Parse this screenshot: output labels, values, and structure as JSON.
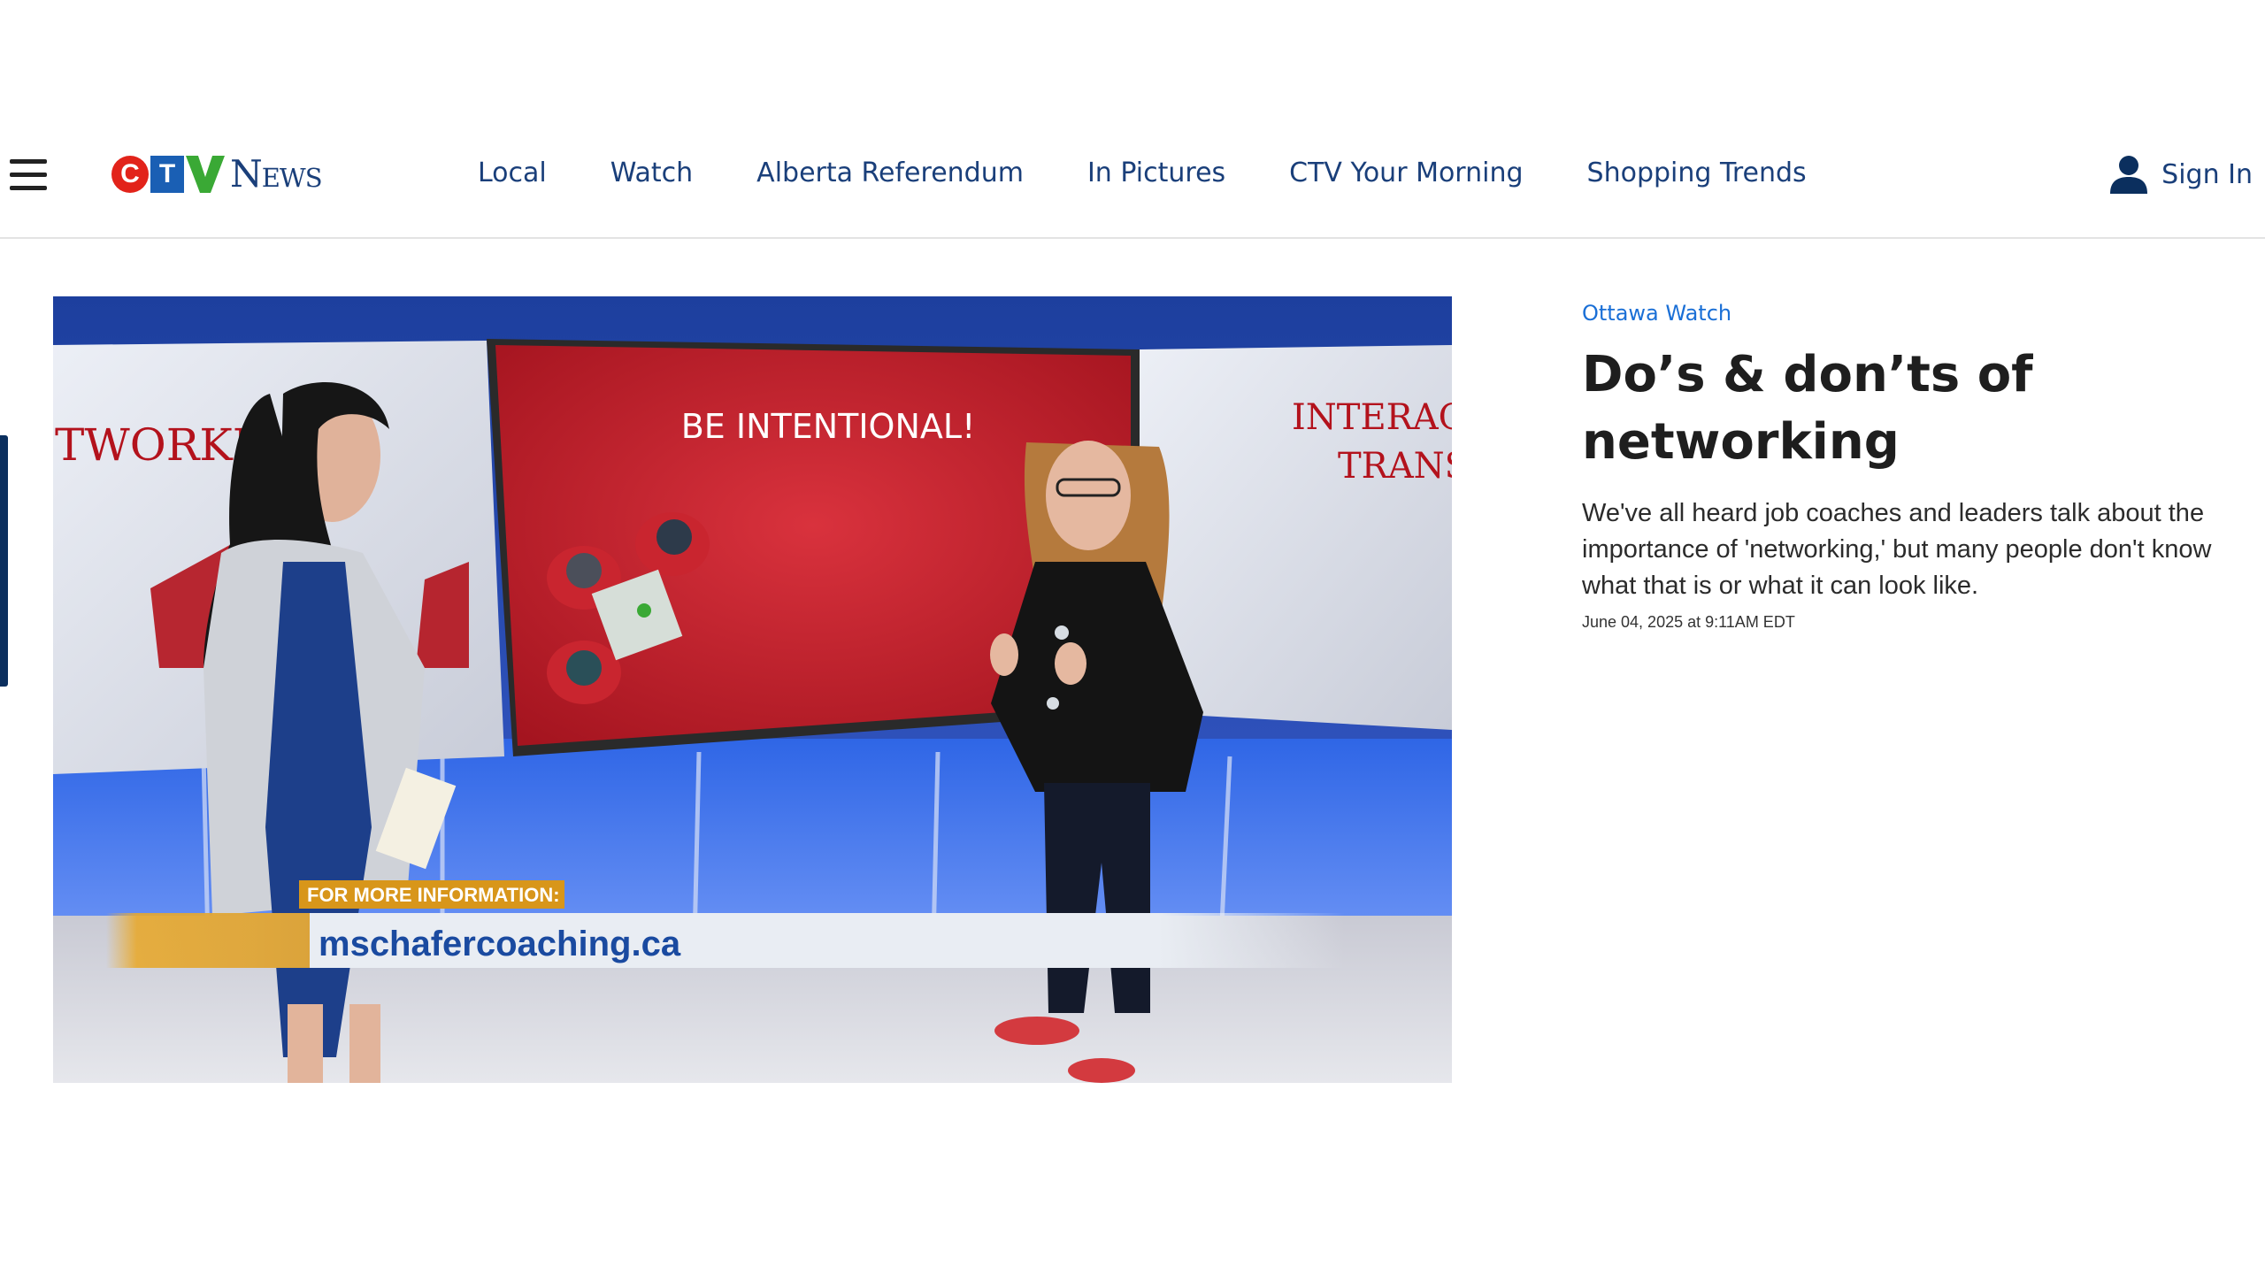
{
  "header": {
    "logo_text": "CTV NEWS",
    "logo_letters": {
      "c": "C",
      "t": "T"
    },
    "logo_news": "News",
    "nav": [
      "Local",
      "Watch",
      "Alberta Referendum",
      "In Pictures",
      "CTV Your Morning",
      "Shopping Trends"
    ],
    "sign_in_label": "Sign In"
  },
  "video": {
    "screen_left_text": "TWORKI",
    "screen_center_text": "BE INTENTIONAL!",
    "screen_right_text_1": "INTERAC",
    "screen_right_text_2": "TRANS",
    "lower_third_label": "FOR MORE INFORMATION:",
    "lower_third_url": "mschafercoaching.ca"
  },
  "article": {
    "section": "Ottawa Watch",
    "headline": "Do’s & don’ts of networking",
    "summary": "We've all heard job coaches and leaders talk about the importance of 'networking,' but many people don't know what that is or what it can look like.",
    "dateline": "June 04, 2025 at 9:11AM EDT"
  },
  "colors": {
    "nav_blue": "#1a3f7a",
    "link_blue": "#1a6fd6",
    "ctv_red": "#e2231a",
    "ctv_blue": "#1a5fb4",
    "ctv_green": "#3aa935"
  },
  "icons": {
    "menu": "hamburger-menu-icon",
    "user": "user-icon",
    "play": "video-player"
  }
}
